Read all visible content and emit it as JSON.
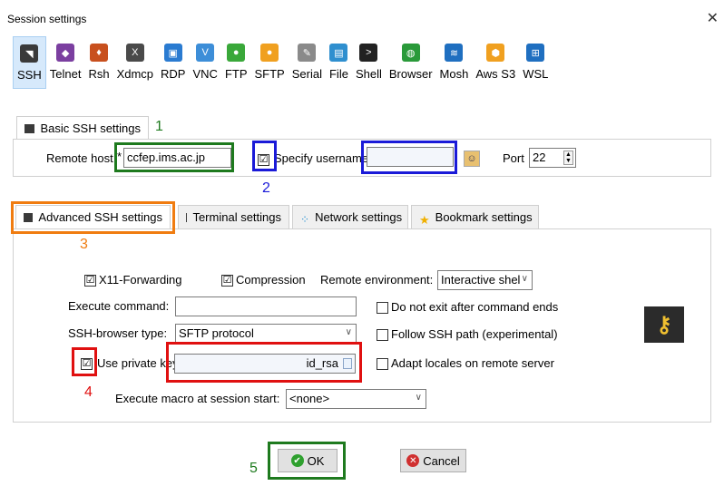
{
  "window": {
    "title": "Session settings",
    "close": "✕"
  },
  "protocols": [
    {
      "label": "SSH",
      "icon": "ssh-icon",
      "color": "#3a3a3a",
      "glyph": "◥"
    },
    {
      "label": "Telnet",
      "icon": "telnet-icon",
      "color": "#7b3fa0",
      "glyph": "◆"
    },
    {
      "label": "Rsh",
      "icon": "rsh-icon",
      "color": "#c8501e",
      "glyph": "♦"
    },
    {
      "label": "Xdmcp",
      "icon": "xdmcp-icon",
      "color": "#4a4a4a",
      "glyph": "X"
    },
    {
      "label": "RDP",
      "icon": "rdp-icon",
      "color": "#2a7bd1",
      "glyph": "▣"
    },
    {
      "label": "VNC",
      "icon": "vnc-icon",
      "color": "#3d8ed8",
      "glyph": "V"
    },
    {
      "label": "FTP",
      "icon": "ftp-icon",
      "color": "#3aa83a",
      "glyph": "●"
    },
    {
      "label": "SFTP",
      "icon": "sftp-icon",
      "color": "#f0a020",
      "glyph": "●"
    },
    {
      "label": "Serial",
      "icon": "serial-icon",
      "color": "#8a8a8a",
      "glyph": "✎"
    },
    {
      "label": "File",
      "icon": "file-icon",
      "color": "#2f8fcf",
      "glyph": "▤"
    },
    {
      "label": "Shell",
      "icon": "shell-icon",
      "color": "#222222",
      "glyph": ">"
    },
    {
      "label": "Browser",
      "icon": "browser-icon",
      "color": "#2a9a3a",
      "glyph": "◍"
    },
    {
      "label": "Mosh",
      "icon": "mosh-icon",
      "color": "#1f6fc0",
      "glyph": "≋"
    },
    {
      "label": "Aws S3",
      "icon": "aws-s3-icon",
      "color": "#f0a020",
      "glyph": "⬢"
    },
    {
      "label": "WSL",
      "icon": "wsl-icon",
      "color": "#1f6fc0",
      "glyph": "⊞"
    }
  ],
  "basic": {
    "tab": "Basic SSH settings",
    "remote_host_label": "Remote host",
    "required_mark": "*",
    "remote_host_value": "ccfep.ims.ac.jp",
    "specify_username_label": "Specify username",
    "specify_username_checked": "☑",
    "username_value": "",
    "port_label": "Port",
    "port_value": "22"
  },
  "tabs": [
    "Advanced SSH settings",
    "Terminal settings",
    "Network settings",
    "Bookmark settings"
  ],
  "advanced": {
    "x11_label": "X11-Forwarding",
    "x11_checked": "☑",
    "compression_label": "Compression",
    "compression_checked": "☑",
    "remote_env_label": "Remote environment:",
    "remote_env_value": "Interactive shel",
    "execute_command_label": "Execute command:",
    "execute_command_value": "",
    "no_exit_label": "Do not exit after command ends",
    "ssh_browser_label": "SSH-browser type:",
    "ssh_browser_value": "SFTP protocol",
    "follow_path_label": "Follow SSH path (experimental)",
    "private_key_label": "Use private key",
    "private_key_checked": "☑",
    "private_key_value": "id_rsa",
    "adapt_locales_label": "Adapt locales on remote server",
    "macro_label": "Execute macro at session start:",
    "macro_value": "<none>"
  },
  "annotations": [
    "1",
    "2",
    "3",
    "4",
    "5"
  ],
  "buttons": {
    "ok": "OK",
    "cancel": "Cancel"
  },
  "colors": {
    "green": "#1e7a1e",
    "blue": "#1a1ad8",
    "orange": "#f07c10",
    "red": "#e01010",
    "accent": "#0078d7"
  }
}
